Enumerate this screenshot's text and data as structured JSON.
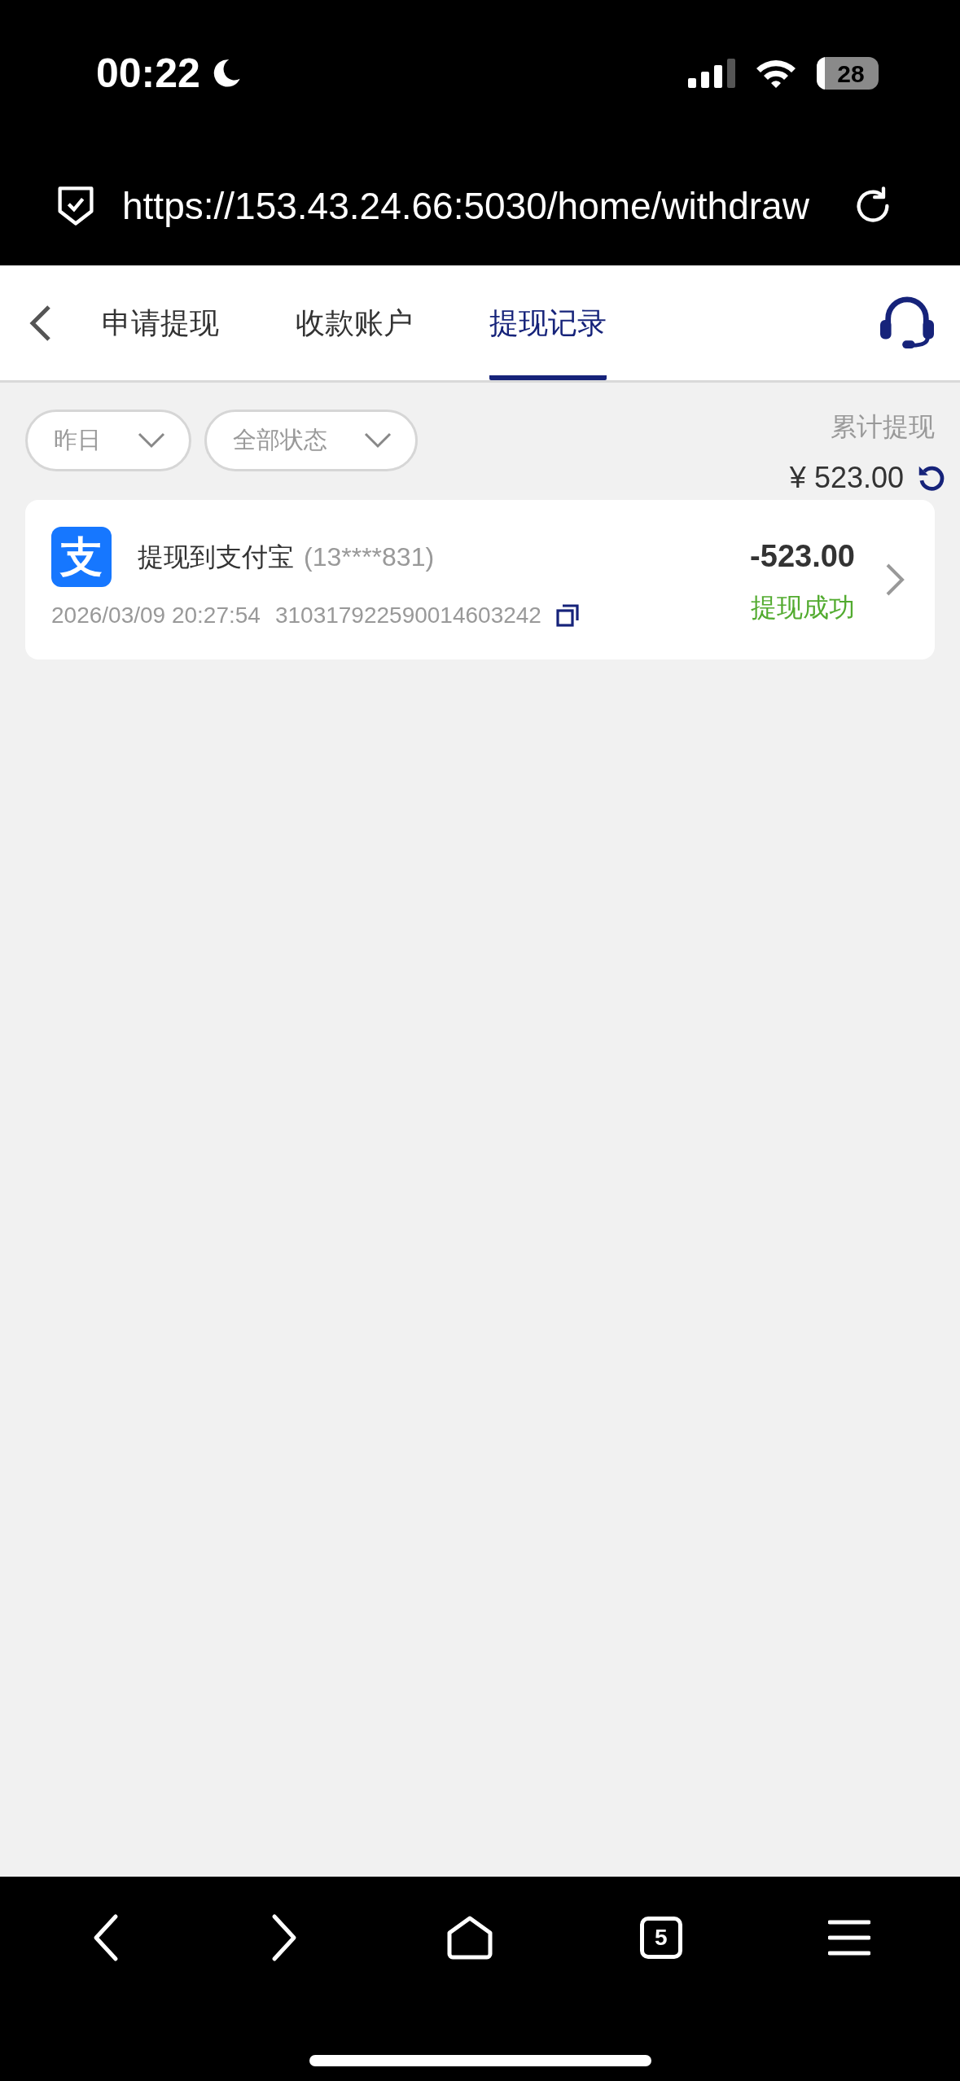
{
  "status_bar": {
    "time": "00:22",
    "battery": "28"
  },
  "address_bar": {
    "url": "https://153.43.24.66:5030/home/withdraw"
  },
  "tabs": [
    {
      "label": "申请提现",
      "selected": false
    },
    {
      "label": "收款账户",
      "selected": false
    },
    {
      "label": "提现记录",
      "selected": true
    }
  ],
  "filters": [
    {
      "label": "昨日"
    },
    {
      "label": "全部状态"
    }
  ],
  "summary": {
    "label": "累计提现",
    "amount": "¥ 523.00"
  },
  "records": [
    {
      "logo": "支",
      "title": "提现到支付宝",
      "account": "(13****831)",
      "time": "2026/03/09 20:27:54",
      "order_no": "310317922590014603242",
      "amount": "-523.00",
      "status": "提现成功",
      "color": "#52ab2f"
    }
  ],
  "browser_toolbar": {
    "tab_count": "5"
  }
}
